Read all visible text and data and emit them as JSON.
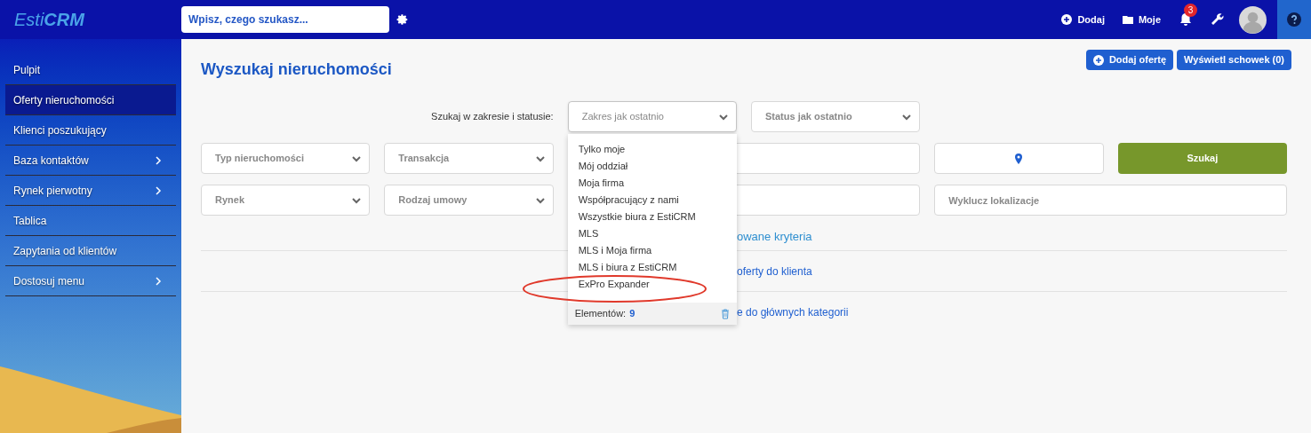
{
  "topbar": {
    "logo": "Esti**CRM**",
    "search": {
      "placeholder": "Wpisz, czego szukasz..."
    },
    "actions": [
      {
        "kind": "add",
        "label": "Dodaj"
      },
      {
        "kind": "folder",
        "label": "Moje"
      },
      {
        "kind": "bell",
        "badge": "3"
      },
      {
        "kind": "wrench"
      },
      {
        "kind": "avatar"
      },
      {
        "kind": "help"
      }
    ]
  },
  "sidebar": {
    "items": [
      {
        "label": "Pulpit",
        "selected": false,
        "expandable": false
      },
      {
        "label": "Oferty nieruchomości",
        "selected": true,
        "expandable": false
      },
      {
        "label": "Klienci poszukujący",
        "selected": false,
        "expandable": false
      },
      {
        "label": "Baza kontaktów",
        "selected": false,
        "expandable": true
      },
      {
        "label": "Rynek pierwotny",
        "selected": false,
        "expandable": true
      },
      {
        "label": "Tablica",
        "selected": false,
        "expandable": false
      },
      {
        "label": "Zapytania od klientów",
        "selected": false,
        "expandable": false
      },
      {
        "label": "Dostosuj menu",
        "selected": false,
        "expandable": true
      }
    ]
  },
  "page": {
    "title": "Wyszukaj nieruchomości",
    "buttons": [
      {
        "kind": "add",
        "label": "Dodaj ofertę"
      },
      {
        "kind": "plain",
        "label": "Wyświetl schowek (0)"
      }
    ]
  },
  "scope": {
    "label": "Szukaj w zakresie i statusie:",
    "range": {
      "placeholder": "Zakres jak ostatnio",
      "expanded": true
    },
    "status": {
      "placeholder": "Status jak ostatnio",
      "expanded": false
    }
  },
  "filters": [
    {
      "kind": "select",
      "placeholder": "Typ nieruchomości"
    },
    {
      "kind": "select",
      "placeholder": "Transakcja"
    },
    {
      "kind": "wide_text"
    },
    {
      "kind": "location"
    },
    {
      "kind": "button",
      "label": "Szukaj"
    },
    {
      "kind": "select",
      "placeholder": "Rynek"
    },
    {
      "kind": "select",
      "placeholder": "Rodzaj umowy"
    },
    {
      "kind": "wide_text"
    },
    {
      "kind": "wide_text",
      "placeholder": "Wyklucz lokalizacje"
    }
  ],
  "links": [
    {
      "kind": "toggle",
      "label": "owane kryteria"
    },
    {
      "kind": "action",
      "label": "oferty do klienta"
    },
    {
      "kind": "action",
      "label": "e do głównych kategorii"
    }
  ],
  "dropdown": {
    "items": [
      {
        "label": "Tylko moje",
        "highlighted": false
      },
      {
        "label": "Mój oddział",
        "highlighted": false
      },
      {
        "label": "Moja firma",
        "highlighted": false
      },
      {
        "label": "Współpracujący z nami",
        "highlighted": false
      },
      {
        "label": "Wszystkie biura z EstiCRM",
        "highlighted": false
      },
      {
        "label": "MLS",
        "highlighted": false
      },
      {
        "label": "MLS i Moja firma",
        "highlighted": false
      },
      {
        "label": "MLS i biura z EstiCRM",
        "highlighted": false
      },
      {
        "label": "ExPro Expander",
        "highlighted": true
      }
    ],
    "footer": {
      "label": "Elementów:",
      "count": "9"
    }
  }
}
